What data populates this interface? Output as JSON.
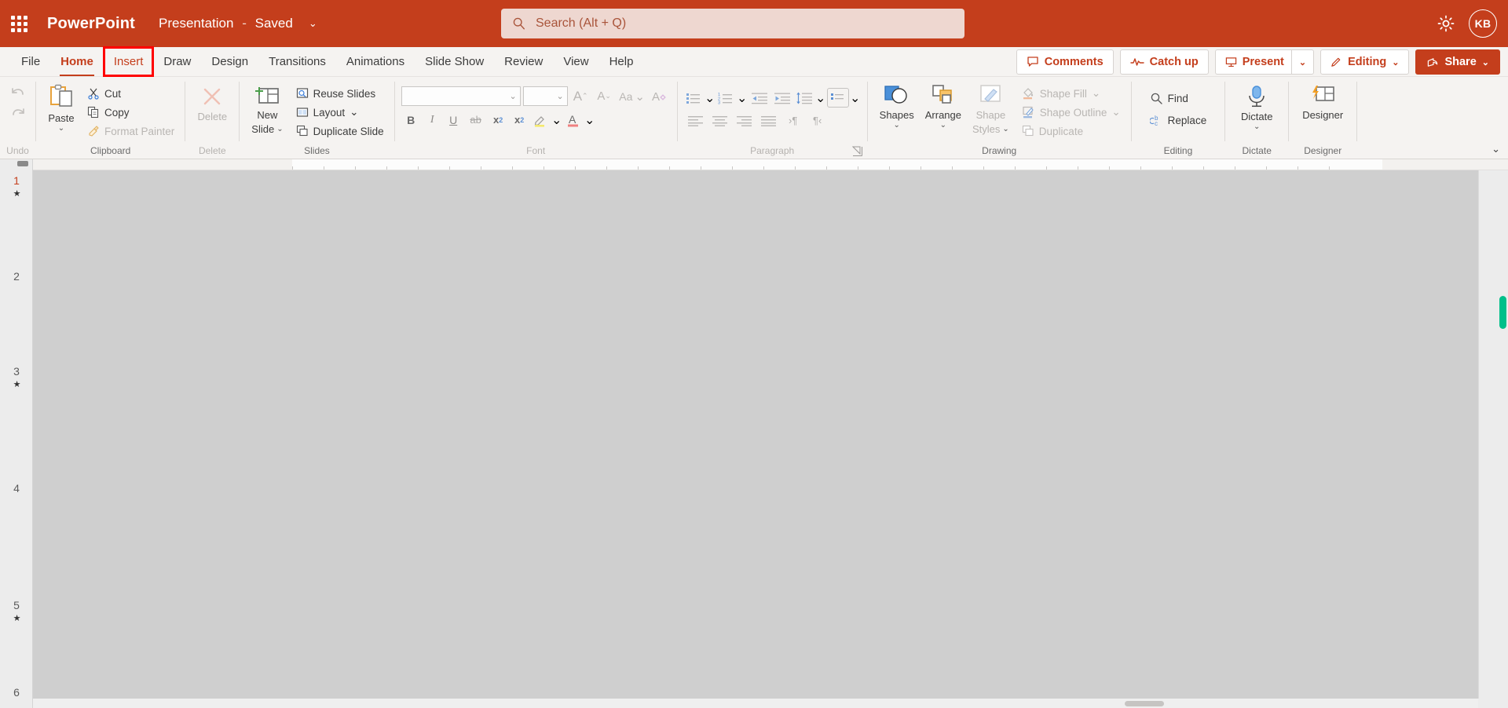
{
  "titlebar": {
    "app_launcher": "app-launcher",
    "app_name": "PowerPoint",
    "doc_name": "Presentation",
    "doc_separator": "-",
    "doc_status": "Saved",
    "doc_caret": "⌄",
    "search": {
      "placeholder": "Search (Alt + Q)",
      "icon": "search-icon"
    },
    "settings_icon": "gear-icon",
    "avatar_initials": "KB",
    "bg_color": "#c43e1c"
  },
  "tabs": [
    {
      "label": "File",
      "state": "normal"
    },
    {
      "label": "Home",
      "state": "active"
    },
    {
      "label": "Insert",
      "state": "highlighted"
    },
    {
      "label": "Draw",
      "state": "normal"
    },
    {
      "label": "Design",
      "state": "normal"
    },
    {
      "label": "Transitions",
      "state": "normal"
    },
    {
      "label": "Animations",
      "state": "normal"
    },
    {
      "label": "Slide Show",
      "state": "normal"
    },
    {
      "label": "Review",
      "state": "normal"
    },
    {
      "label": "View",
      "state": "normal"
    },
    {
      "label": "Help",
      "state": "normal"
    }
  ],
  "tabstrip_actions": {
    "comments": "Comments",
    "catch_up": "Catch up",
    "present": "Present",
    "present_caret": "⌄",
    "editing": "Editing",
    "editing_caret": "⌄",
    "share": "Share",
    "share_caret": "⌄",
    "highlight_color": "#ff0000"
  },
  "ribbon": {
    "undo": {
      "group_label": "Undo",
      "undo_label": "undo-arrow",
      "redo_label": "redo-arrow"
    },
    "clipboard": {
      "group_label": "Clipboard",
      "paste": "Paste",
      "paste_caret": "⌄",
      "cut": "Cut",
      "copy": "Copy",
      "format_painter": "Format Painter"
    },
    "delete": {
      "group_label": "Delete",
      "delete": "Delete"
    },
    "slides": {
      "group_label": "Slides",
      "new_slide_line1": "New",
      "new_slide_line2": "Slide",
      "new_slide_caret": "⌄",
      "reuse_slides": "Reuse Slides",
      "layout": "Layout",
      "layout_caret": "⌄",
      "duplicate_slide": "Duplicate Slide"
    },
    "font": {
      "group_label": "Font",
      "font_name_value": "",
      "font_size_value": "",
      "grow_font": "A",
      "shrink_font": "A",
      "change_case": "Aa",
      "clear_formatting": "A",
      "bold": "B",
      "italic": "I",
      "underline": "U",
      "strikethrough": "ab",
      "subscript": "x",
      "superscript": "x",
      "text_highlight": "highlight-icon",
      "font_color": "A"
    },
    "paragraph": {
      "group_label": "Paragraph",
      "bullets": "bullets-icon",
      "numbering": "numbering-icon",
      "decrease_indent": "decrease-indent-icon",
      "increase_indent": "increase-indent-icon",
      "line_spacing": "line-spacing-icon",
      "columns": "columns-icon",
      "align_left": "align-left-icon",
      "align_center": "align-center-icon",
      "align_right": "align-right-icon",
      "justify": "justify-icon",
      "ltr": "›¶",
      "rtl": "¶‹",
      "dialog_launcher": "dialog-launcher-icon"
    },
    "drawing": {
      "group_label": "Drawing",
      "shapes": "Shapes",
      "shapes_caret": "⌄",
      "arrange": "Arrange",
      "arrange_caret": "⌄",
      "shape_styles_line1": "Shape",
      "shape_styles_line2": "Styles",
      "shape_styles_caret": "⌄",
      "shape_fill": "Shape Fill",
      "shape_fill_caret": "⌄",
      "shape_outline": "Shape Outline",
      "shape_outline_caret": "⌄",
      "duplicate": "Duplicate"
    },
    "editing": {
      "group_label": "Editing",
      "find": "Find",
      "replace": "Replace"
    },
    "dictate": {
      "group_label": "Dictate",
      "dictate": "Dictate",
      "dictate_caret": "⌄"
    },
    "designer": {
      "group_label": "Designer",
      "designer": "Designer"
    },
    "collapse_caret": "⌄"
  },
  "slide_pane": {
    "slides": [
      {
        "number": "1",
        "animated": true,
        "current": true
      },
      {
        "number": "2",
        "animated": false,
        "current": false
      },
      {
        "number": "3",
        "animated": true,
        "current": false
      },
      {
        "number": "4",
        "animated": false,
        "current": false
      },
      {
        "number": "5",
        "animated": true,
        "current": false
      },
      {
        "number": "6",
        "animated": false,
        "current": false
      }
    ],
    "animation_glyph": "★"
  },
  "canvas": {
    "background_color": "#cfcfcf"
  },
  "scrollbars": {
    "vertical_thumb_color": "#00bf8a",
    "horizontal_thumb_color": "#c6c4c2"
  }
}
